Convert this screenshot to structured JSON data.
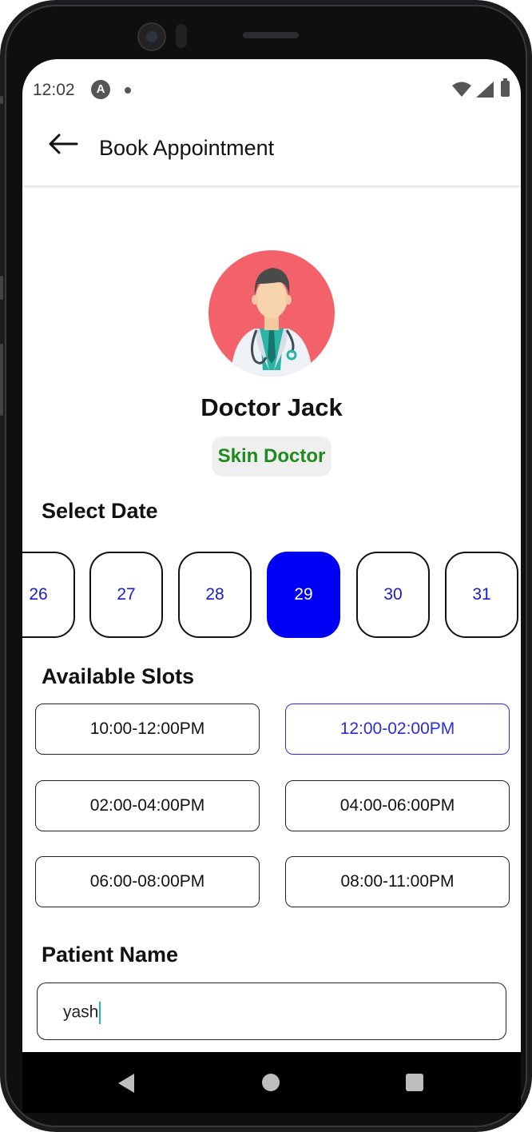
{
  "statusbar": {
    "time": "12:02",
    "app_icon_letter": "A"
  },
  "appbar": {
    "title": "Book Appointment"
  },
  "doctor": {
    "name": "Doctor Jack",
    "specialty": "Skin Doctor"
  },
  "date_section": {
    "label": "Select Date",
    "dates": [
      "26",
      "27",
      "28",
      "29",
      "30",
      "31"
    ],
    "selected": "29"
  },
  "slots_section": {
    "label": "Available Slots",
    "slots": [
      "10:00-12:00PM",
      "12:00-02:00PM",
      "02:00-04:00PM",
      "04:00-06:00PM",
      "06:00-08:00PM",
      "08:00-11:00PM"
    ],
    "selected": "12:00-02:00PM"
  },
  "patient": {
    "label": "Patient Name",
    "value": "yash"
  },
  "colors": {
    "selected_date_bg": "#0000f5",
    "date_text": "#1a1ad6",
    "specialty_text": "#1f8a1f",
    "avatar_bg": "#f3626a",
    "caret": "#1fb8a8"
  }
}
